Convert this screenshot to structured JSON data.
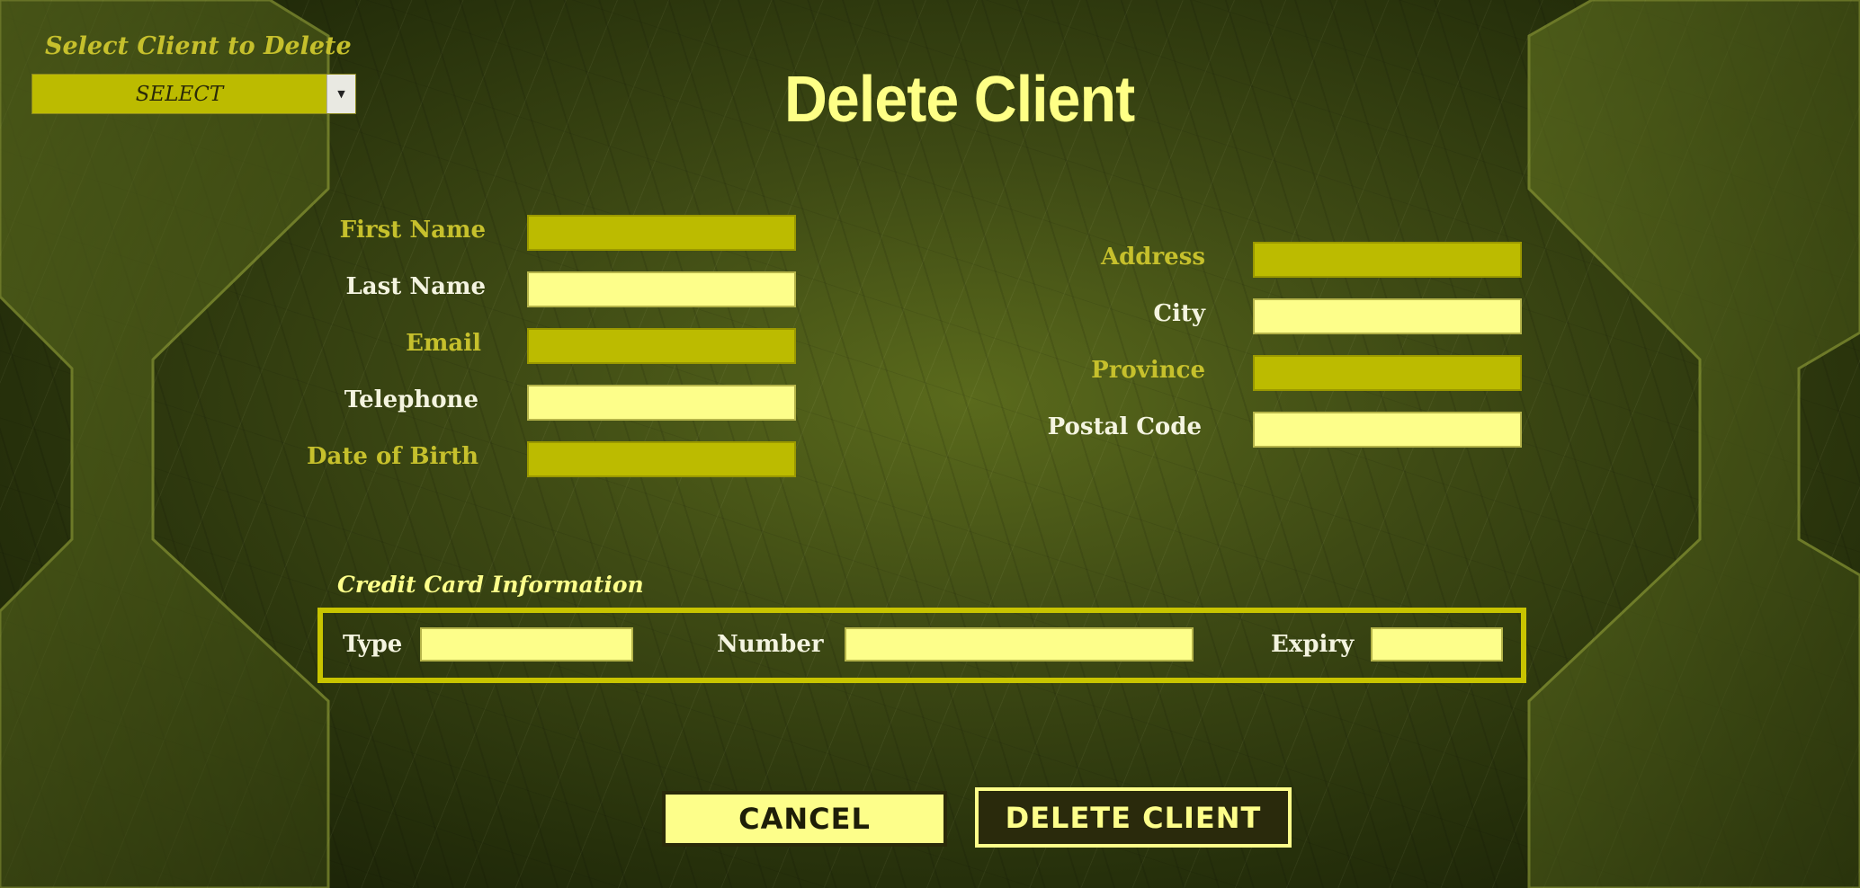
{
  "header": {
    "select_label": "Select Client to Delete",
    "select_value": "SELECT",
    "title": "Delete Client"
  },
  "client_fields": {
    "first_name": {
      "label": "First Name",
      "value": ""
    },
    "last_name": {
      "label": "Last Name",
      "value": ""
    },
    "email": {
      "label": "Email",
      "value": ""
    },
    "telephone": {
      "label": "Telephone",
      "value": ""
    },
    "dob": {
      "label": "Date of Birth",
      "value": ""
    }
  },
  "address_fields": {
    "address": {
      "label": "Address",
      "value": ""
    },
    "city": {
      "label": "City",
      "value": ""
    },
    "province": {
      "label": "Province",
      "value": ""
    },
    "postal_code": {
      "label": "Postal Code",
      "value": ""
    }
  },
  "credit_card": {
    "title": "Credit Card Information",
    "type_label": "Type",
    "number_label": "Number",
    "expiry_label": "Expiry",
    "type_value": "",
    "number_value": "",
    "expiry_value": ""
  },
  "buttons": {
    "cancel": "CANCEL",
    "delete": "DELETE CLIENT"
  },
  "colors": {
    "field_dark": "#bcbb00",
    "field_light": "#fdfe8a",
    "label_dark": "#c6c02c",
    "label_light": "#f4f4e0",
    "title": "#feff86"
  }
}
